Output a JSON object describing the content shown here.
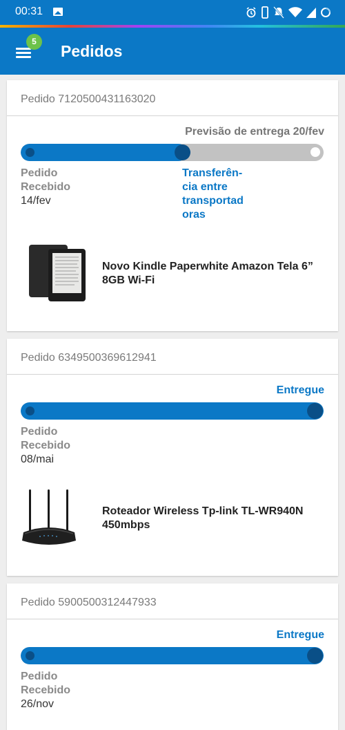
{
  "status_bar": {
    "time": "00:31",
    "icons": [
      "gallery-icon",
      "alarm-icon",
      "vibrate-icon",
      "mute-icon",
      "wifi-icon",
      "signal-icon",
      "battery-icon"
    ]
  },
  "app_bar": {
    "title": "Pedidos",
    "menu_badge": "5"
  },
  "colors": {
    "primary": "#0b78c6",
    "dark_dot": "#0a4f87",
    "badge": "#6cc24a",
    "track": "#c2c2c2"
  },
  "orders": [
    {
      "header": "Pedido 7120500431163020",
      "status": "Previsão de entrega 20/fev",
      "progress": 0.55,
      "step_received_label_1": "Pedido",
      "step_received_label_2": "Recebido",
      "step_received_date": "14/fev",
      "current_step_lines": [
        "Transferên-",
        "cia entre",
        "transportad",
        "oras"
      ],
      "product_name": "Novo Kindle Paperwhite Amazon Tela 6” 8GB Wi-Fi",
      "product_icon": "kindle-image"
    },
    {
      "header": "Pedido 6349500369612941",
      "status": "Entregue",
      "progress": 1.0,
      "step_received_label_1": "Pedido",
      "step_received_label_2": "Recebido",
      "step_received_date": "08/mai",
      "product_name": "Roteador Wireless Tp-link TL-WR940N 450mbps",
      "product_icon": "router-image"
    },
    {
      "header": "Pedido 5900500312447933",
      "status": "Entregue",
      "progress": 1.0,
      "step_received_label_1": "Pedido",
      "step_received_label_2": "Recebido",
      "step_received_date": "26/nov"
    }
  ]
}
